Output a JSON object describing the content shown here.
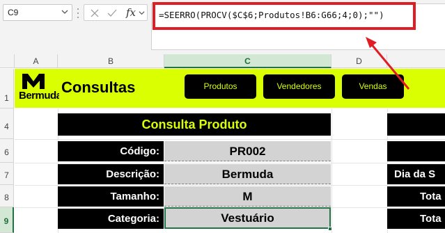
{
  "name_box": {
    "value": "C9"
  },
  "formula_bar": {
    "fx_label": "fx",
    "formula": "=SEERRO(PROCV($C$6;Produtos!B6:G66;4;0);\"\")"
  },
  "columns": [
    "A",
    "B",
    "C",
    "D"
  ],
  "rows": [
    "1",
    "4",
    "6",
    "7",
    "8",
    "9"
  ],
  "banner": {
    "logo_text": "Bermudas",
    "title": "Consultas",
    "nav_buttons": [
      "Produtos",
      "Vendedores",
      "Vendas"
    ]
  },
  "consulta_produto": {
    "title": "Consulta Produto",
    "fields": [
      {
        "label": "Código:",
        "value": "PR002"
      },
      {
        "label": "Descrição:",
        "value": "Bermuda"
      },
      {
        "label": "Tamanho:",
        "value": "M"
      },
      {
        "label": "Categoria:",
        "value": "Vestuário"
      }
    ]
  },
  "right_panel": {
    "labels": [
      "Dia da S",
      "Tota",
      "Tota"
    ]
  },
  "colors": {
    "accent_yellow": "#d9ff00",
    "excel_green": "#217346",
    "highlight_red": "#e01c24",
    "cell_gray": "#d3d3d3"
  }
}
